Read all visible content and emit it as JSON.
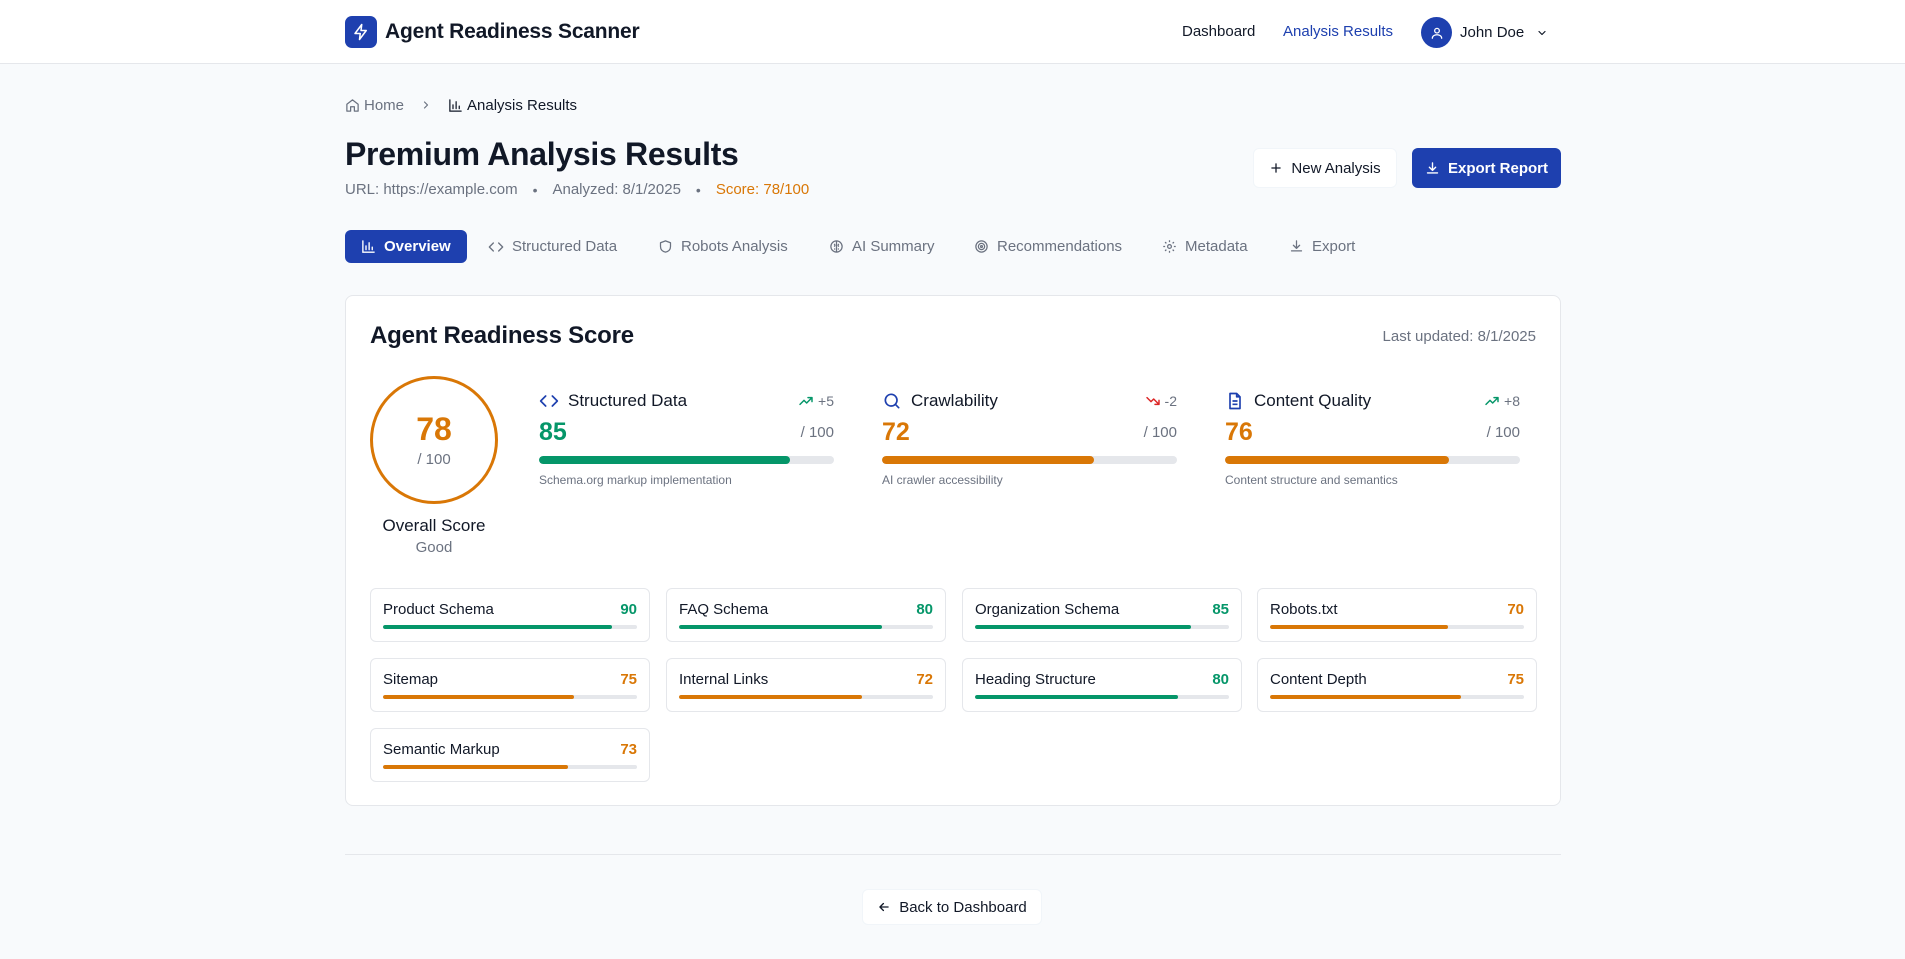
{
  "app": {
    "brand_name": "Agent Readiness Scanner",
    "nav": {
      "dashboard": "Dashboard",
      "analysis_results": "Analysis Results"
    },
    "user": {
      "name": "John Doe"
    }
  },
  "breadcrumb": {
    "home": "Home",
    "current": "Analysis Results"
  },
  "page": {
    "title": "Premium Analysis Results",
    "url": "URL: https://example.com",
    "analyzed": "Analyzed: 8/1/2025",
    "score": "Score: 78/100",
    "separator": "•",
    "new_analysis": "New Analysis",
    "export_report": "Export Report"
  },
  "tabs": [
    {
      "label": "Overview",
      "icon": "bar-chart-icon",
      "active": true
    },
    {
      "label": "Structured Data",
      "icon": "code-icon",
      "active": false
    },
    {
      "label": "Robots Analysis",
      "icon": "shield-icon",
      "active": false
    },
    {
      "label": "AI Summary",
      "icon": "brain-icon",
      "active": false
    },
    {
      "label": "Recommendations",
      "icon": "target-icon",
      "active": false
    },
    {
      "label": "Metadata",
      "icon": "gear-icon",
      "active": false
    },
    {
      "label": "Export",
      "icon": "download-icon",
      "active": false
    }
  ],
  "readiness": {
    "title": "Agent Readiness Score",
    "last_updated": "Last updated: 8/1/2025",
    "overall": {
      "value": "78",
      "max": "/ 100",
      "label": "Overall Score",
      "status": "Good"
    },
    "metrics": [
      {
        "name": "Structured Data",
        "icon": "code-icon",
        "delta": "+5",
        "trend": "up",
        "value": "85",
        "max": "/ 100",
        "progress": 0.85,
        "description": "Schema.org markup implementation",
        "color": "#059669"
      },
      {
        "name": "Crawlability",
        "icon": "search-icon",
        "delta": "-2",
        "trend": "down",
        "value": "72",
        "max": "/ 100",
        "progress": 0.72,
        "description": "AI crawler accessibility",
        "color": "#d97706"
      },
      {
        "name": "Content Quality",
        "icon": "document-icon",
        "delta": "+8",
        "trend": "up",
        "value": "76",
        "max": "/ 100",
        "progress": 0.76,
        "description": "Content structure and semantics",
        "color": "#d97706"
      }
    ],
    "subscores": [
      {
        "name": "Product Schema",
        "value": "90",
        "progress": 0.9,
        "color": "#059669"
      },
      {
        "name": "FAQ Schema",
        "value": "80",
        "progress": 0.8,
        "color": "#059669"
      },
      {
        "name": "Organization Schema",
        "value": "85",
        "progress": 0.85,
        "color": "#059669"
      },
      {
        "name": "Robots.txt",
        "value": "70",
        "progress": 0.7,
        "color": "#d97706"
      },
      {
        "name": "Sitemap",
        "value": "75",
        "progress": 0.75,
        "color": "#d97706"
      },
      {
        "name": "Internal Links",
        "value": "72",
        "progress": 0.72,
        "color": "#d97706"
      },
      {
        "name": "Heading Structure",
        "value": "80",
        "progress": 0.8,
        "color": "#059669"
      },
      {
        "name": "Content Depth",
        "value": "75",
        "progress": 0.75,
        "color": "#d97706"
      },
      {
        "name": "Semantic Markup",
        "value": "73",
        "progress": 0.73,
        "color": "#d97706"
      }
    ]
  },
  "footer": {
    "back_label": "Back to Dashboard"
  },
  "colors": {
    "primary": "#1e40af",
    "good": "#059669",
    "warning": "#d97706",
    "negative": "#dc2626"
  }
}
